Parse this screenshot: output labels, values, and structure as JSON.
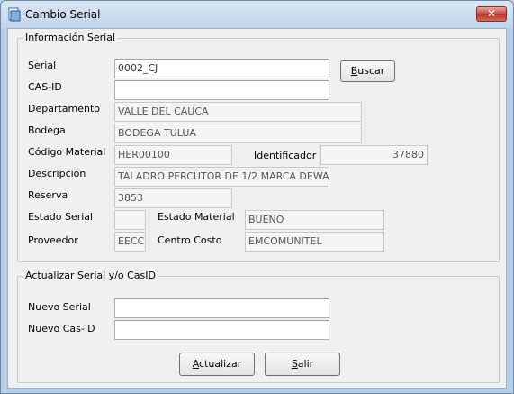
{
  "window": {
    "title": "Cambio Serial",
    "close_glyph": "✕",
    "icon": "app-icon"
  },
  "info": {
    "legend": "Información Serial",
    "serial_label": "Serial",
    "serial_value": "0002_CJ",
    "buscar_pre": "",
    "buscar_ul": "B",
    "buscar_post": "uscar",
    "casid_label": "CAS-ID",
    "casid_value": "",
    "departamento_label": "Departamento",
    "departamento_value": "VALLE DEL CAUCA",
    "bodega_label": "Bodega",
    "bodega_value": "BODEGA TULUA",
    "codigo_label": "Código Material",
    "codigo_value": "HER00100",
    "identificador_label": "Identificador",
    "identificador_value": "37880",
    "descripcion_label": "Descripción",
    "descripcion_value": "TALADRO PERCUTOR DE 1/2 MARCA DEWA",
    "reserva_label": "Reserva",
    "reserva_value": "3853",
    "estado_serial_label": "Estado Serial",
    "estado_serial_value": "",
    "estado_material_label": "Estado Material",
    "estado_material_value": "BUENO",
    "proveedor_label": "Proveedor",
    "proveedor_value": "EECC",
    "centro_costo_label": "Centro Costo",
    "centro_costo_value": "EMCOMUNITEL"
  },
  "update": {
    "legend": "Actualizar Serial y/o CasID",
    "nuevo_serial_label": "Nuevo Serial",
    "nuevo_serial_value": "",
    "nuevo_casid_label": "Nuevo Cas-ID",
    "nuevo_casid_value": "",
    "actualizar_ul": "A",
    "actualizar_post": "ctualizar",
    "salir_ul": "S",
    "salir_post": "alir"
  }
}
